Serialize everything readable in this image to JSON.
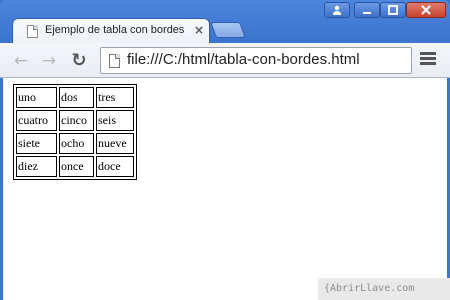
{
  "browser": {
    "tab": {
      "title": "Ejemplo de tabla con bordes",
      "close_glyph": "×"
    },
    "toolbar": {
      "back_glyph": "←",
      "forward_glyph": "→",
      "reload_glyph": "↻",
      "url": "file:///C:/html/tabla-con-bordes.html"
    },
    "window_controls": {
      "user_icon": "user-icon",
      "minimize_icon": "minimize-icon",
      "maximize_icon": "maximize-icon",
      "close_icon": "close-icon"
    }
  },
  "table": {
    "rows": [
      [
        "uno",
        "dos",
        "tres"
      ],
      [
        "cuatro",
        "cinco",
        "seis"
      ],
      [
        "siete",
        "ocho",
        "nueve"
      ],
      [
        "diez",
        "once",
        "doce"
      ]
    ]
  },
  "watermark": {
    "text": "{AbrirLlave.com"
  },
  "colors": {
    "titlebar": "#3c74cf",
    "close_button": "#c7412f",
    "page_background": "#ffffff"
  }
}
